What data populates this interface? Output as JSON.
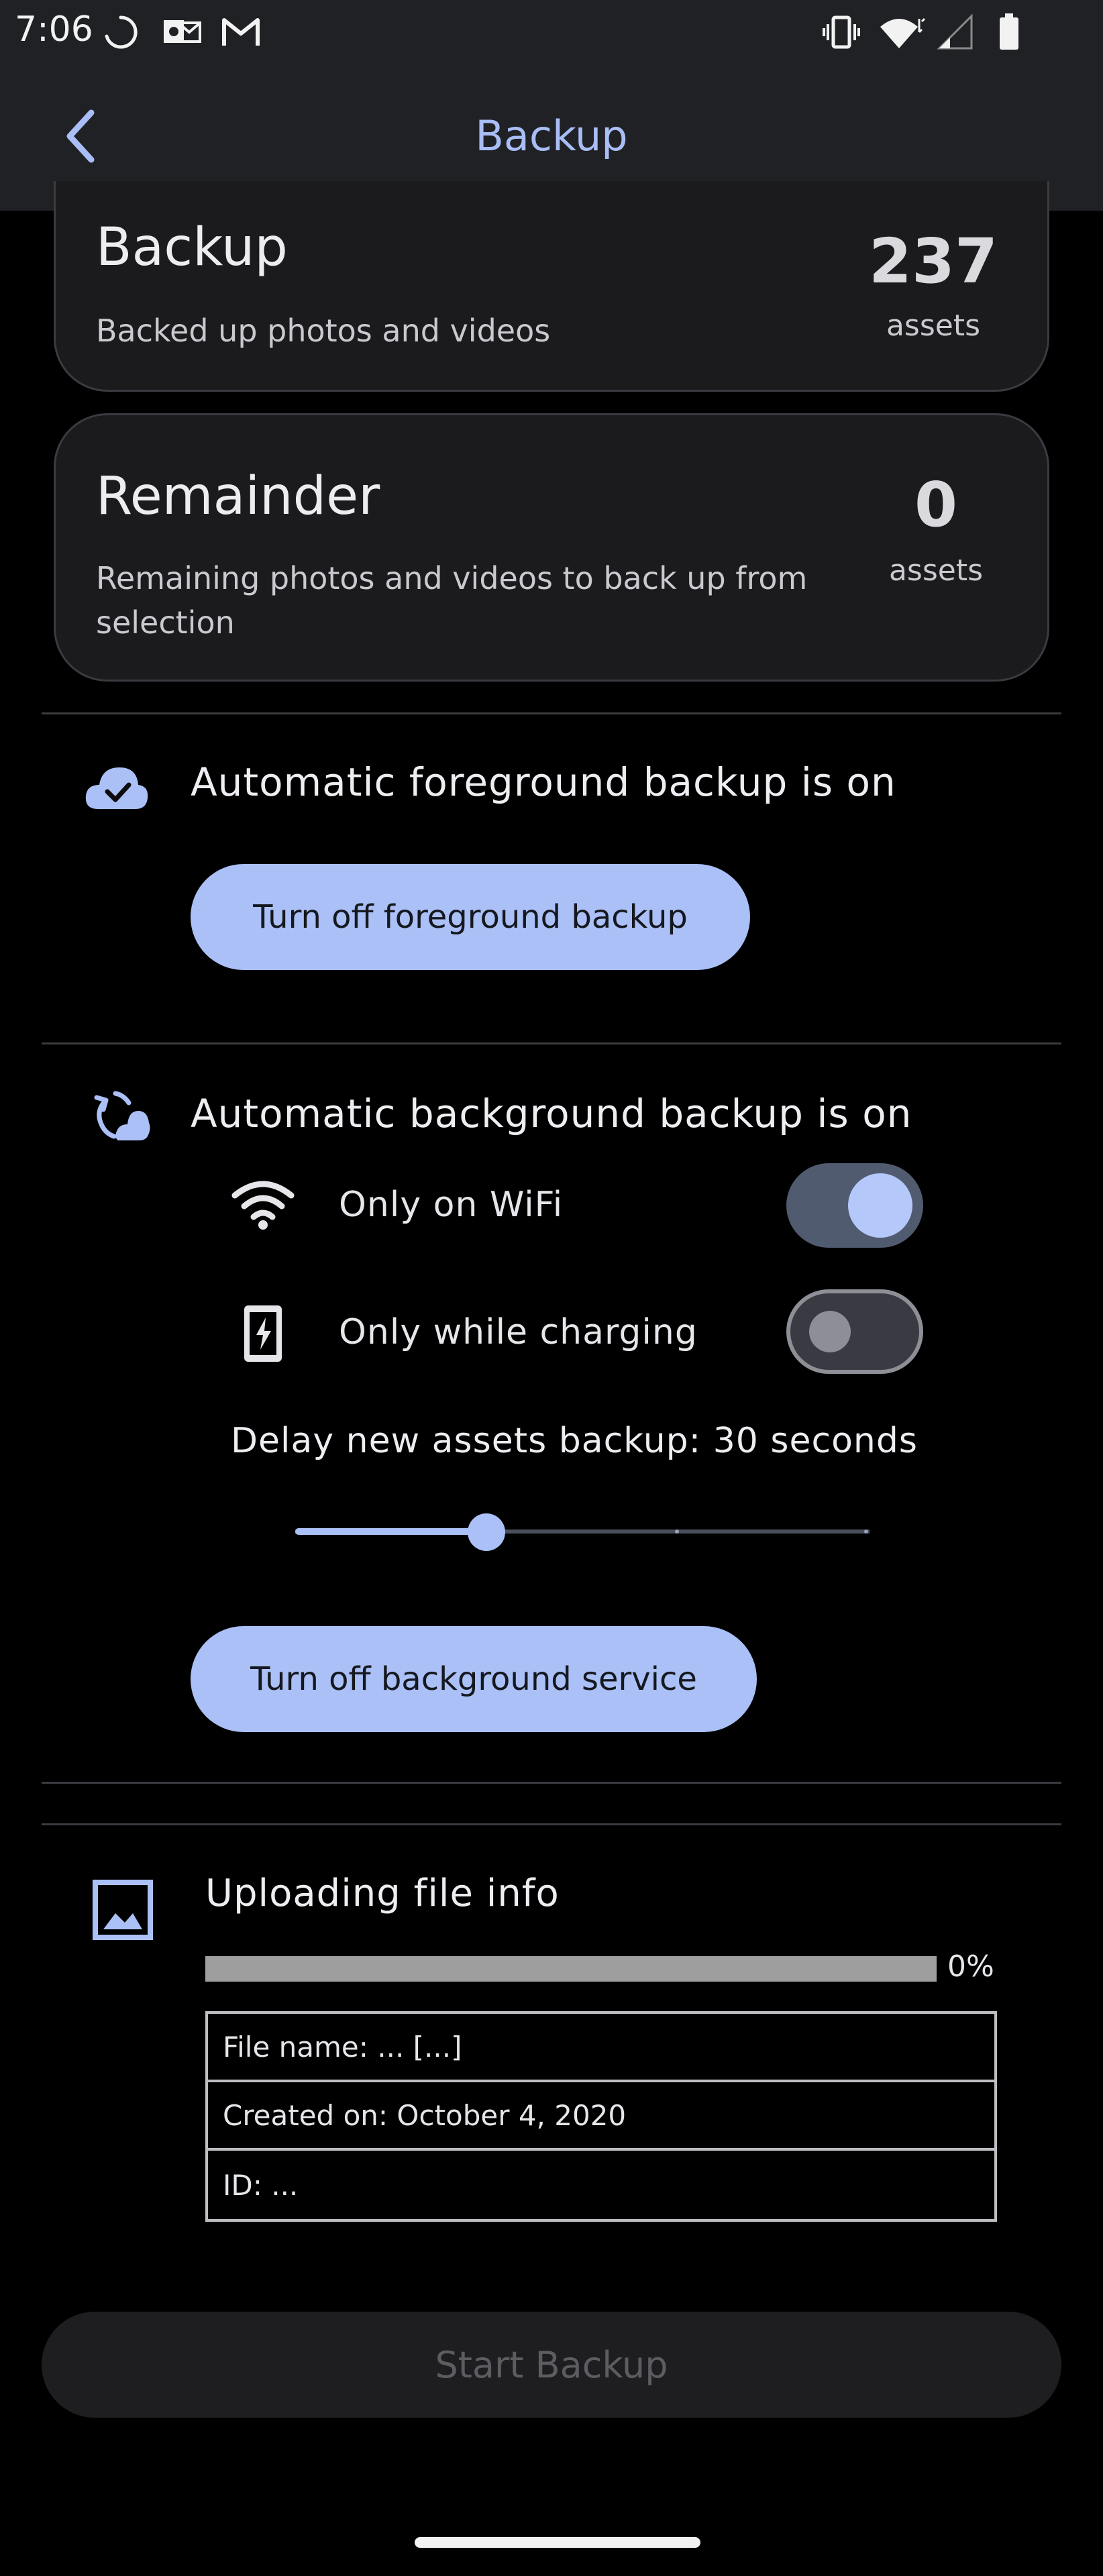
{
  "status_bar": {
    "time": "7:06",
    "left_icons": [
      "loading-icon",
      "outlook-icon",
      "gmail-icon"
    ],
    "right_icons": [
      "vibrate-icon",
      "wifi-icon",
      "signal-icon",
      "battery-icon"
    ]
  },
  "app_bar": {
    "title": "Backup",
    "back_icon": "chevron-left-icon"
  },
  "backup_card": {
    "title": "Backup",
    "subtitle": "Backed up photos and videos",
    "count": "237",
    "unit": "assets"
  },
  "remainder_card": {
    "title": "Remainder",
    "subtitle_line1": "Remaining photos and videos to back up from",
    "subtitle_line2": "selection",
    "count": "0",
    "unit": "assets"
  },
  "foreground": {
    "status": "Automatic foreground backup is on",
    "button": "Turn off foreground backup",
    "icon": "cloud-check-icon"
  },
  "background": {
    "status": "Automatic background backup is on",
    "icon": "cloud-sync-icon",
    "wifi_label": "Only on WiFi",
    "wifi_on": true,
    "charging_label": "Only while charging",
    "charging_on": false,
    "delay_label": "Delay new assets backup: 30 seconds",
    "slider_fraction": 0.333,
    "button": "Turn off background service"
  },
  "upload": {
    "title": "Uploading file info",
    "icon": "image-icon",
    "progress_value": 0,
    "progress_text": "0%",
    "file_name": "File name: ... [...]",
    "created_on": "Created on: October 4, 2020",
    "id": "ID: ..."
  },
  "start_button": "Start Backup",
  "colors": {
    "accent": "#aac0f6",
    "background": "#000000",
    "surface": "#1b1b1e",
    "bar": "#202124"
  }
}
